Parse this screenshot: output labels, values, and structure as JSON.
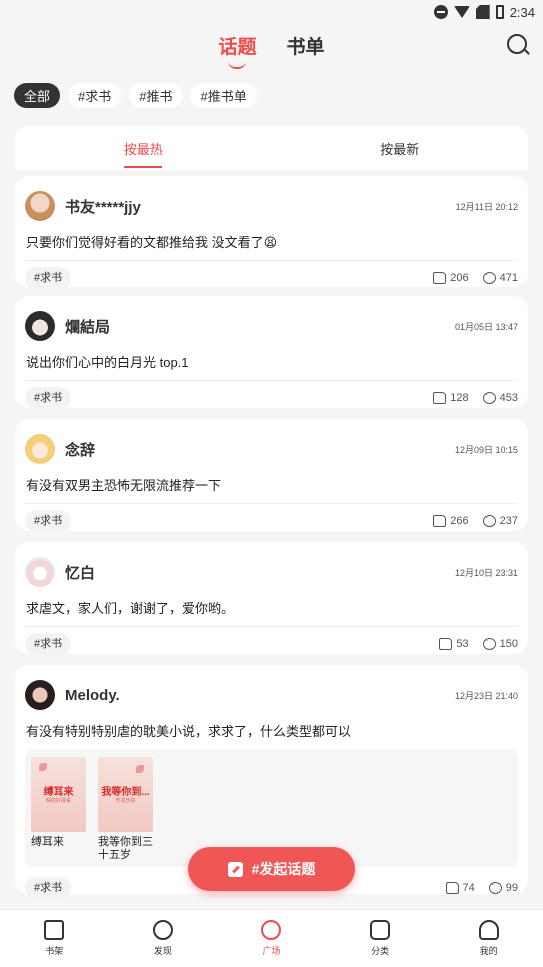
{
  "status_bar": {
    "time": "2:34"
  },
  "top_tabs": [
    {
      "label": "话题",
      "active": true
    },
    {
      "label": "书单",
      "active": false
    }
  ],
  "filter_chips": [
    {
      "label": "全部",
      "active": true
    },
    {
      "label": "#求书",
      "active": false
    },
    {
      "label": "#推书",
      "active": false
    },
    {
      "label": "#推书单",
      "active": false
    }
  ],
  "sort_tabs": [
    {
      "label": "按最热",
      "active": true
    },
    {
      "label": "按最新",
      "active": false
    }
  ],
  "posts": [
    {
      "username": "书友*****jjy",
      "date": "12月11日 20:12",
      "text": "只要你们觉得好看的文都推给我 没文看了😫",
      "tag": "#求书",
      "likes": "206",
      "comments": "471"
    },
    {
      "username": "爛結局",
      "date": "01月05日 13:47",
      "text": "说出你们心中的白月光 top.1",
      "tag": "#求书",
      "likes": "128",
      "comments": "453"
    },
    {
      "username": "念辞",
      "date": "12月09日 10:15",
      "text": "有没有双男主恐怖无限流推荐一下",
      "tag": "#求书",
      "likes": "266",
      "comments": "237"
    },
    {
      "username": "忆白",
      "date": "12月10日 23:31",
      "text": "求虐文，家人们，谢谢了，爱你哟。",
      "tag": "#求书",
      "likes": "53",
      "comments": "150"
    },
    {
      "username": "Melody.",
      "date": "12月23日 21:40",
      "text": "有没有特别特别虐的耽美小说，求求了，什么类型都可以",
      "tag": "#求书",
      "likes": "74",
      "comments": "99",
      "books": [
        {
          "title": "缚耳来",
          "cover_text": "缚耳来",
          "cover_sub": "缺的好耳来"
        },
        {
          "title": "我等你到三十五岁",
          "cover_text": "我等你到...",
          "cover_sub": "齐龙乐好"
        }
      ]
    }
  ],
  "fab": {
    "label": "#发起话题"
  },
  "bottom_nav": [
    {
      "label": "书架",
      "icon": "bookshelf-icon",
      "active": false
    },
    {
      "label": "发现",
      "icon": "discover-icon",
      "active": false
    },
    {
      "label": "广场",
      "icon": "plaza-icon",
      "active": true
    },
    {
      "label": "分类",
      "icon": "category-icon",
      "active": false
    },
    {
      "label": "我的",
      "icon": "profile-icon",
      "active": false
    }
  ],
  "colors": {
    "accent": "#ef4b4b",
    "fab": "#f05656",
    "background": "#f5f5f5"
  }
}
